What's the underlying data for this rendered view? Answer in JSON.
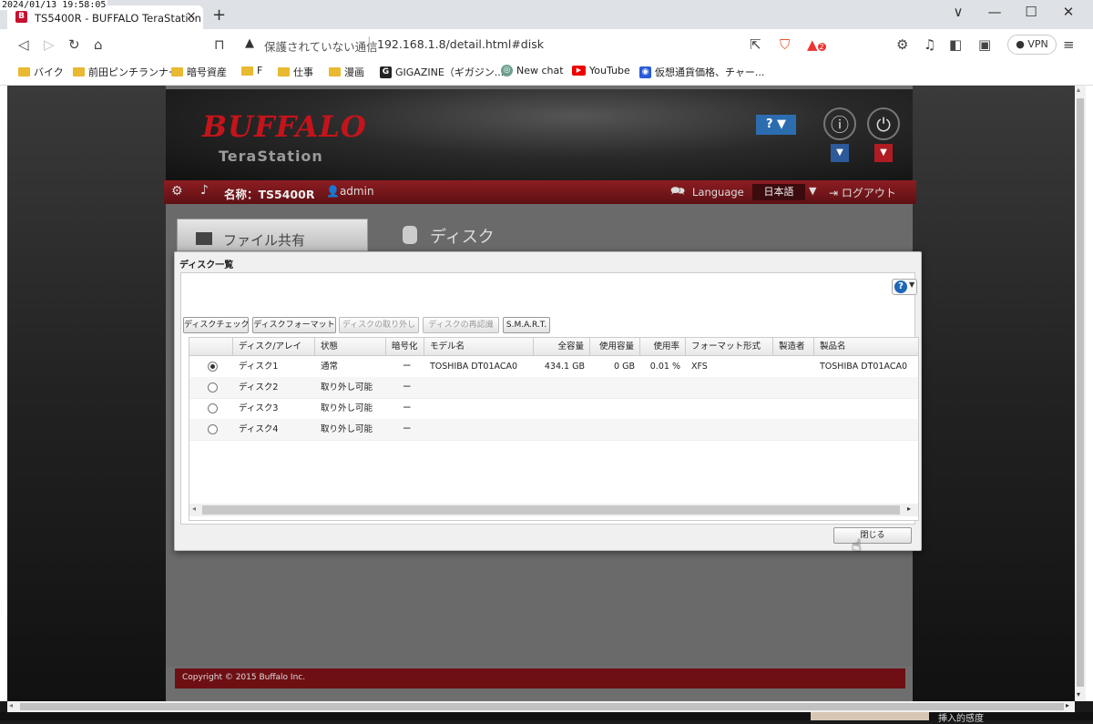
{
  "timestamp": "2024/01/13 19:58:05",
  "browser": {
    "tab_title": "TS5400R - BUFFALO TeraStation",
    "tab_close": "×",
    "new_tab": "+",
    "win_min": "—",
    "win_max": "☐",
    "win_close": "✕",
    "win_dropdown": "∨",
    "url_insecure": "保護されていない通信",
    "url": "192.168.1.8/detail.html#disk",
    "vpn": "VPN",
    "brave_badge": "2"
  },
  "bookmarks": [
    {
      "label": "バイク",
      "type": "folder"
    },
    {
      "label": "前田ピンチランナー",
      "type": "folder"
    },
    {
      "label": "暗号資産",
      "type": "folder"
    },
    {
      "label": "F",
      "type": "folder"
    },
    {
      "label": "仕事",
      "type": "folder"
    },
    {
      "label": "漫画",
      "type": "folder"
    },
    {
      "label": "GIGAZINE（ギガジン...",
      "type": "site"
    },
    {
      "label": "New chat",
      "type": "site"
    },
    {
      "label": "YouTube",
      "type": "site"
    },
    {
      "label": "仮想通貨価格、チャー...",
      "type": "site"
    }
  ],
  "nas": {
    "logo": "BUFFALO",
    "product": "TeraStation",
    "help_label": "? ▼",
    "device_name": "名称：TS5400R",
    "user": "admin",
    "language_label": "Language",
    "language_value": "日本語",
    "logout": "ログアウト",
    "nav_file_share": "ファイル共有",
    "page_title": "ディスク",
    "footer": "Copyright © 2015 Buffalo Inc."
  },
  "dialog": {
    "title": "ディスク一覧",
    "buttons": {
      "disk_check": "ディスクチェック",
      "disk_format": "ディスクフォーマット",
      "disk_remove": "ディスクの取り外し",
      "disk_recognize": "ディスクの再認識",
      "smart": "S.M.A.R.T."
    },
    "columns": [
      "ディスク/アレイ",
      "状態",
      "暗号化",
      "モデル名",
      "全容量",
      "使用容量",
      "使用率",
      "フォーマット形式",
      "製造者",
      "製品名"
    ],
    "rows": [
      {
        "disk": "ディスク1",
        "status": "通常",
        "enc": "ー",
        "model": "TOSHIBA DT01ACA0",
        "total": "434.1 GB",
        "used": "0 GB",
        "rate": "0.01 %",
        "format": "XFS",
        "maker": "",
        "product": "TOSHIBA DT01ACA0",
        "selected": true
      },
      {
        "disk": "ディスク2",
        "status": "取り外し可能",
        "enc": "ー",
        "model": "",
        "total": "",
        "used": "",
        "rate": "",
        "format": "",
        "maker": "",
        "product": "",
        "selected": false
      },
      {
        "disk": "ディスク3",
        "status": "取り外し可能",
        "enc": "ー",
        "model": "",
        "total": "",
        "used": "",
        "rate": "",
        "format": "",
        "maker": "",
        "product": "",
        "selected": false
      },
      {
        "disk": "ディスク4",
        "status": "取り外し可能",
        "enc": "ー",
        "model": "",
        "total": "",
        "used": "",
        "rate": "",
        "format": "",
        "maker": "",
        "product": "",
        "selected": false
      }
    ],
    "close": "閉じる"
  },
  "taskbar_text": "挿入的感度"
}
